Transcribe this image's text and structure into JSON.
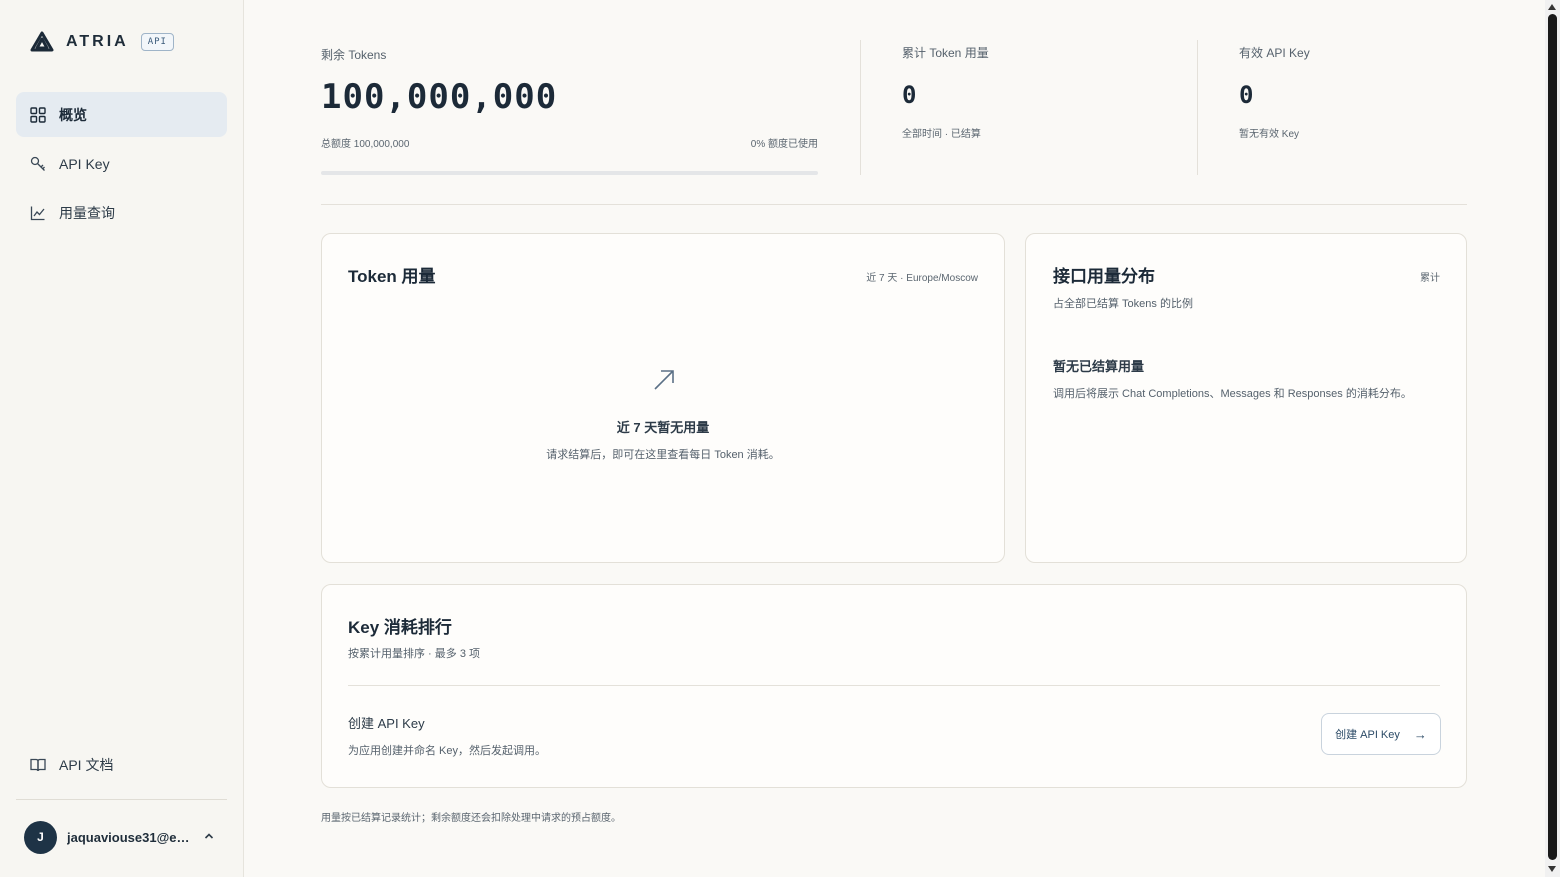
{
  "brand": {
    "name": "ATRIA",
    "badge": "API"
  },
  "sidebar": {
    "items": [
      {
        "label": "概览",
        "icon": "grid-icon",
        "active": true
      },
      {
        "label": "API Key",
        "icon": "key-icon",
        "active": false
      },
      {
        "label": "用量查询",
        "icon": "chart-line-icon",
        "active": false
      }
    ],
    "docs": {
      "label": "API 文档",
      "icon": "book-icon"
    },
    "user": {
      "initial": "J",
      "email": "jaquaviouse31@eld..."
    }
  },
  "stats": {
    "remaining": {
      "label": "剩余 Tokens",
      "value": "100,000,000",
      "total": "总额度 100,000,000",
      "used": "0% 额度已使用",
      "used_fraction": 0
    },
    "cumulative": {
      "label": "累计 Token 用量",
      "value": "0",
      "sub": "全部时间 · 已结算"
    },
    "active_keys": {
      "label": "有效 API Key",
      "value": "0",
      "sub": "暂无有效 Key"
    }
  },
  "token_usage": {
    "title": "Token 用量",
    "meta": "近 7 天 · Europe/Moscow",
    "empty_title": "近 7 天暂无用量",
    "empty_desc": "请求结算后，即可在这里查看每日 Token 消耗。"
  },
  "distribution": {
    "title": "接口用量分布",
    "meta": "累计",
    "subtitle": "占全部已结算 Tokens 的比例",
    "empty_title": "暂无已结算用量",
    "empty_desc": "调用后将展示 Chat Completions、Messages 和 Responses 的消耗分布。"
  },
  "ranking": {
    "title": "Key 消耗排行",
    "subtitle": "按累计用量排序 · 最多 3 项",
    "cta_title": "创建 API Key",
    "cta_desc": "为应用创建并命名 Key，然后发起调用。",
    "button_label": "创建 API Key",
    "button_arrow": "→"
  },
  "footnote": "用量按已结算记录统计；剩余额度还会扣除处理中请求的预占额度。"
}
